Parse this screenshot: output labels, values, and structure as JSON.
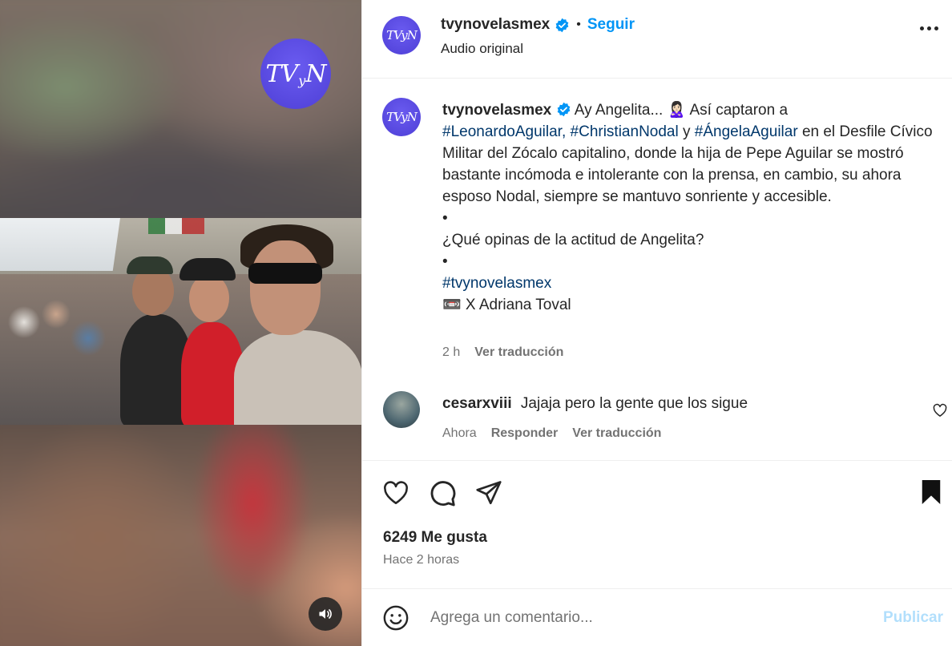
{
  "media": {
    "brand_badge": {
      "main": "TV",
      "small": "y",
      "end": "N"
    },
    "sound_icon": "volume-icon"
  },
  "header": {
    "avatar_text": "TVyN",
    "username": "tvynovelasmex",
    "separator": "•",
    "follow_label": "Seguir",
    "audio_label": "Audio original",
    "more_icon": "more-options-icon"
  },
  "caption": {
    "avatar_text": "TVyN",
    "username": "tvynovelasmex",
    "intro": "Ay Angelita... 🙎🏻‍♀️ Así captaron a",
    "tag1": "#LeonardoAguilar,",
    "tag2": "#ChristianNodal",
    "and": "y",
    "tag3": "#ÁngelaAguilar",
    "body": "en el Desfile Cívico Militar del Zócalo capitalino, donde la hija de Pepe Aguilar se mostró bastante incómoda e intolerante con la prensa, en cambio, su ahora esposo Nodal, siempre se mantuvo sonriente y accesible.",
    "bullet1": "•",
    "question": "¿Qué opinas de la actitud de Angelita?",
    "bullet2": "•",
    "hashtag": "#tvynovelasmex",
    "credit": "📼 X Adriana Toval",
    "time": "2 h",
    "translate": "Ver traducción"
  },
  "comment": {
    "username": "cesarxviii",
    "text": "Jajaja pero la gente que los sigue",
    "time": "Ahora",
    "reply": "Responder",
    "translate": "Ver traducción"
  },
  "actions": {
    "likes": "6249 Me gusta",
    "time_ago": "Hace 2 horas",
    "icons": [
      "heart-icon",
      "comment-icon",
      "share-icon",
      "bookmark-icon"
    ]
  },
  "composer": {
    "placeholder": "Agrega un comentario...",
    "publish_label": "Publicar"
  },
  "colors": {
    "accent": "#0095f6",
    "link": "#00376b",
    "muted": "#737373",
    "brand": "#5a4be3",
    "publish_disabled": "#b2dffc"
  }
}
